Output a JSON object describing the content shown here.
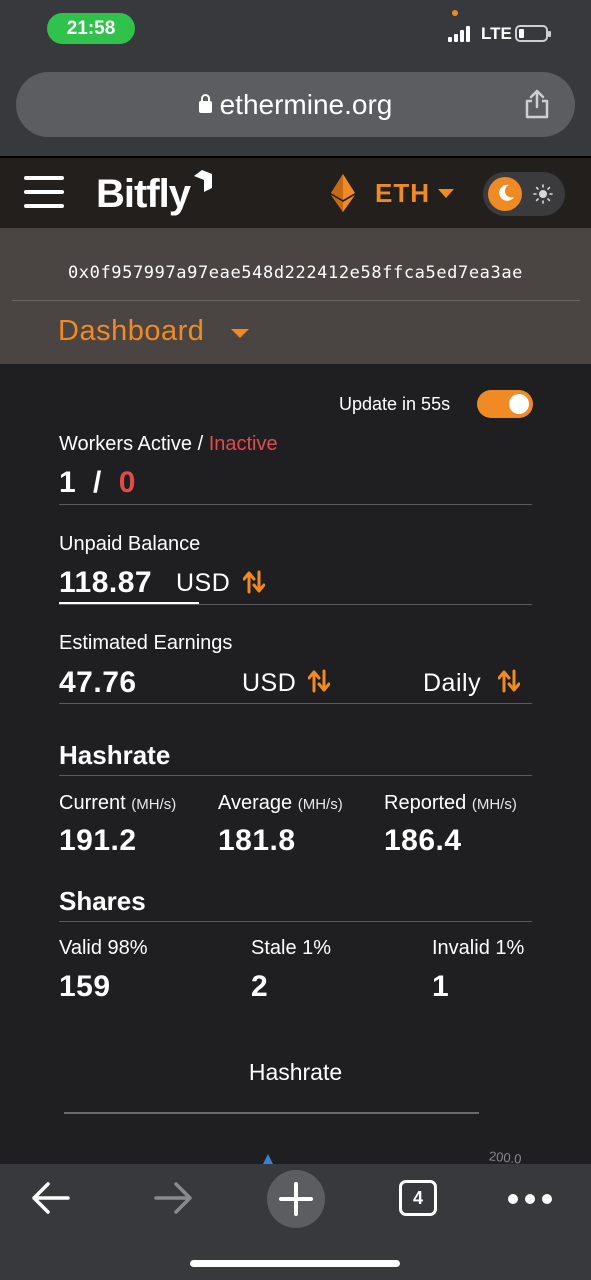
{
  "status_bar": {
    "time": "21:58",
    "network": "LTE"
  },
  "browser": {
    "url": "ethermine.org",
    "tab_count": "4"
  },
  "header": {
    "brand": "Bitfly",
    "currency": "ETH"
  },
  "wallet": {
    "address": "0x0f957997a97eae548d222412e58ffca5ed7ea3ae",
    "section": "Dashboard"
  },
  "update": {
    "label": "Update in 55s",
    "enabled": true
  },
  "workers": {
    "label_active": "Workers Active",
    "separator": "/",
    "label_inactive": "Inactive",
    "active": "1",
    "slash": "/",
    "inactive": "0"
  },
  "unpaid": {
    "label": "Unpaid Balance",
    "value": "118.87",
    "unit": "USD"
  },
  "earnings": {
    "label": "Estimated Earnings",
    "value": "47.76",
    "unit": "USD",
    "period": "Daily"
  },
  "hashrate": {
    "title": "Hashrate",
    "unit": "(MH/s)",
    "current_label": "Current",
    "current": "191.2",
    "average_label": "Average",
    "average": "181.8",
    "reported_label": "Reported",
    "reported": "186.4"
  },
  "shares": {
    "title": "Shares",
    "valid_label": "Valid 98%",
    "valid": "159",
    "stale_label": "Stale 1%",
    "stale": "2",
    "invalid_label": "Invalid 1%",
    "invalid": "1"
  },
  "chart": {
    "title": "Hashrate",
    "tick": "200.0"
  },
  "colors": {
    "accent": "#f08a24",
    "danger": "#e04b4b",
    "background": "#1f1f21"
  }
}
